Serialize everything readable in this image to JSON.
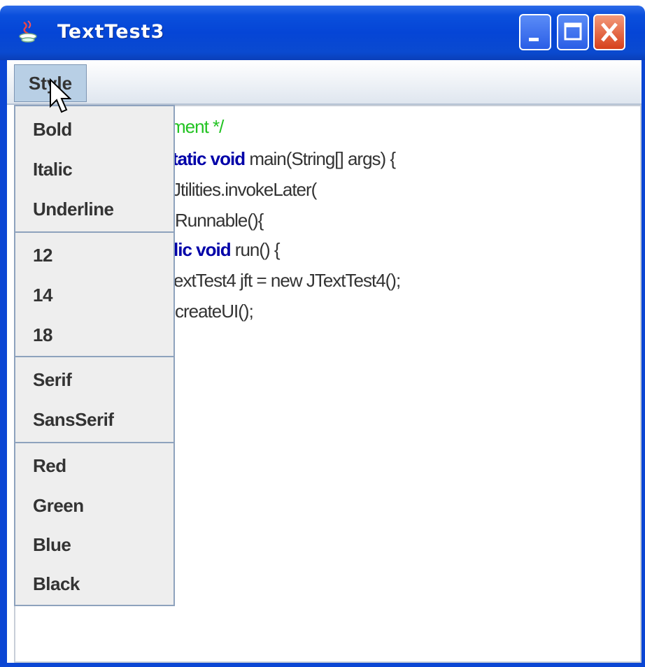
{
  "window": {
    "title": "TextTest3"
  },
  "titlebar": {
    "icons": [
      "java-icon",
      "minimize-icon",
      "maximize-icon",
      "close-icon"
    ]
  },
  "menubar": {
    "menus": [
      {
        "label": "Style"
      }
    ]
  },
  "editor": {
    "lines": [
      {
        "segments": [
          {
            "text": "ment */",
            "style": "comment"
          }
        ]
      },
      {
        "segments": [
          {
            "text": "tatic void",
            "style": "keyword"
          },
          {
            "text": " main(String[] args) {",
            "style": "plain"
          }
        ]
      },
      {
        "segments": [
          {
            "text": "Jtilities.invokeLater(",
            "style": "plain"
          }
        ]
      },
      {
        "segments": [
          {
            "text": "Runnable(){",
            "style": "plain"
          }
        ]
      },
      {
        "segments": [
          {
            "text": "lic void",
            "style": "keyword"
          },
          {
            "text": " run() {",
            "style": "plain"
          }
        ]
      },
      {
        "segments": [
          {
            "text": "extTest4 jft = new JTextTest4();",
            "style": "plain"
          }
        ]
      },
      {
        "segments": [
          {
            "text": "createUI();",
            "style": "plain"
          }
        ]
      }
    ]
  },
  "style_menu": {
    "groups": [
      [
        "Bold",
        "Italic",
        "Underline"
      ],
      [
        "12",
        "14",
        "18"
      ],
      [
        "Serif",
        "SansSerif"
      ],
      [
        "Red",
        "Green",
        "Blue",
        "Black"
      ]
    ]
  },
  "colors": {
    "titlebar": "#0545d6",
    "keyword": "#0000a8",
    "comment": "#22c322",
    "menu_highlight": "#b8cfe5"
  }
}
